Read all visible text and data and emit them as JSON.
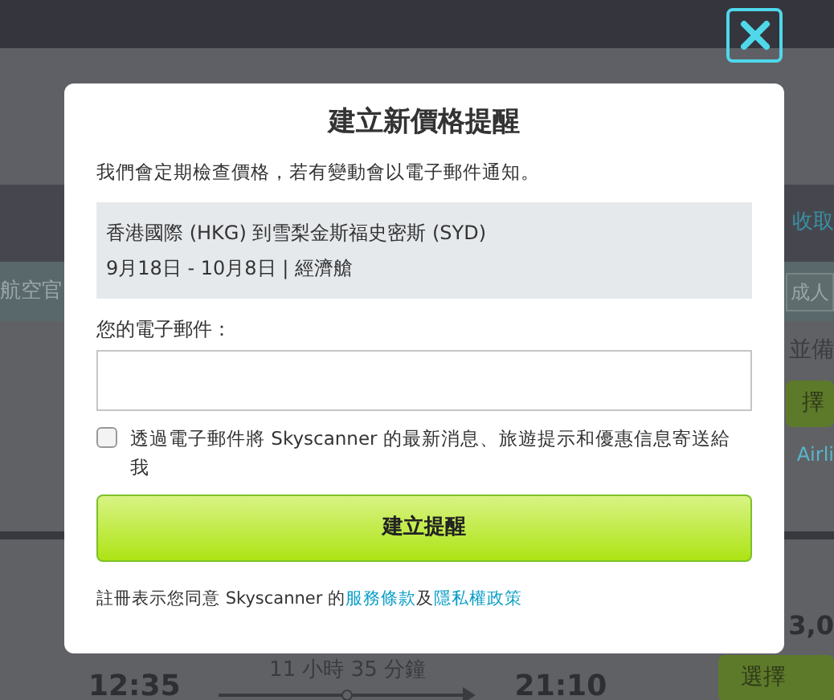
{
  "background": {
    "header_link": "收取",
    "left_label": "航空官",
    "right_field": "成人",
    "right_heading": "並備",
    "right_button": "擇",
    "airline_link": "Airli",
    "price": "3,0",
    "select_button": "選擇",
    "depart_time": "12:35",
    "duration": "11 小時 35 分鐘",
    "arrive_time": "21:10"
  },
  "dialog": {
    "title": "建立新價格提醒",
    "intro": "我們會定期檢查價格，若有變動會以電子郵件通知。",
    "route": {
      "places": "香港國際 (HKG) 到雪梨金斯福史密斯 (SYD)",
      "dates": "9月18日 - 10月8日 | 經濟艙"
    },
    "email_label": "您的電子郵件：",
    "newsletter": {
      "label": "透過電子郵件將 Skyscanner 的最新消息、旅遊提示和優惠信息寄送給我",
      "checked": false
    },
    "submit": "建立提醒",
    "legal": {
      "before": "註冊表示您同意 Skyscanner 的",
      "terms": "服務條款",
      "joiner": "及",
      "privacy": "隱私權政策"
    }
  }
}
